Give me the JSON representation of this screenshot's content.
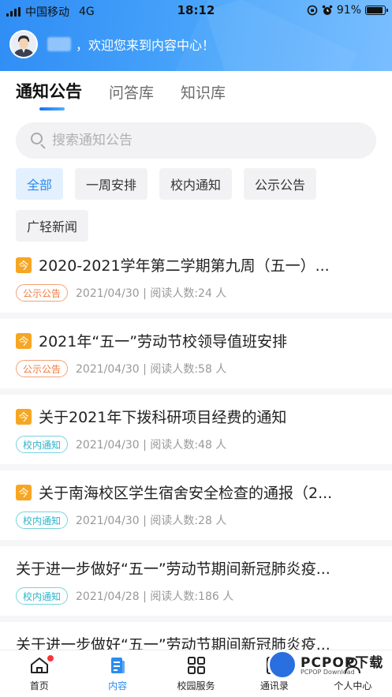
{
  "status_bar": {
    "carrier": "中国移动",
    "network": "4G",
    "time": "18:12",
    "battery": "91%",
    "battery_level": 0.91
  },
  "header": {
    "welcome_text": "，欢迎您来到内容中心！"
  },
  "tabs": [
    {
      "label": "通知公告",
      "active": true
    },
    {
      "label": "问答库",
      "active": false
    },
    {
      "label": "知识库",
      "active": false
    }
  ],
  "search": {
    "placeholder": "搜索通知公告",
    "value": ""
  },
  "filters": [
    {
      "label": "全部",
      "active": true
    },
    {
      "label": "一周安排"
    },
    {
      "label": "校内通知"
    },
    {
      "label": "公示公告"
    },
    {
      "label": "广轻新闻"
    }
  ],
  "notices": [
    {
      "title": "2020-2021学年第二学期第九周（五一）...",
      "pinned": true,
      "tag": "公示公告",
      "meta": "2021/04/30 | 阅读人数:24 人"
    },
    {
      "title": "2021年“五一”劳动节校领导值班安排",
      "pinned": true,
      "tag": "公示公告",
      "meta": "2021/04/30 | 阅读人数:58 人"
    },
    {
      "title": "关于2021年下拨科研项目经费的通知",
      "pinned": true,
      "tag": "校内通知",
      "meta": "2021/04/30 | 阅读人数:48 人"
    },
    {
      "title": "关于南海校区学生宿舍安全检查的通报（2...",
      "pinned": true,
      "tag": "校内通知",
      "meta": "2021/04/30 | 阅读人数:28 人"
    },
    {
      "title": "关于进一步做好“五一”劳动节期间新冠肺炎疫...",
      "pinned": false,
      "tag": "校内通知",
      "meta": "2021/04/28 | 阅读人数:186 人"
    },
    {
      "title": "关于进一步做好“五一”劳动节期间新冠肺炎疫...",
      "pinned": false,
      "tag": "",
      "meta": ""
    }
  ],
  "pin_icon_char": "今",
  "bottom_nav": [
    {
      "label": "首页",
      "icon": "home-icon"
    },
    {
      "label": "内容",
      "icon": "document-icon",
      "active": true
    },
    {
      "label": "校园服务",
      "icon": "grid-icon"
    },
    {
      "label": "通讯录",
      "icon": "contacts-icon"
    },
    {
      "label": "个人中心",
      "icon": "person-icon"
    }
  ],
  "watermark": {
    "text": "PCPOP下载",
    "sub": "PCPOP Download"
  },
  "colors": {
    "accent": "#2b8cf0",
    "header_start": "#2f8df5",
    "pin": "#f6a623",
    "tag_orange": "#f07a3c",
    "tag_teal": "#2cb6c9",
    "badge_red": "#f5363b"
  }
}
